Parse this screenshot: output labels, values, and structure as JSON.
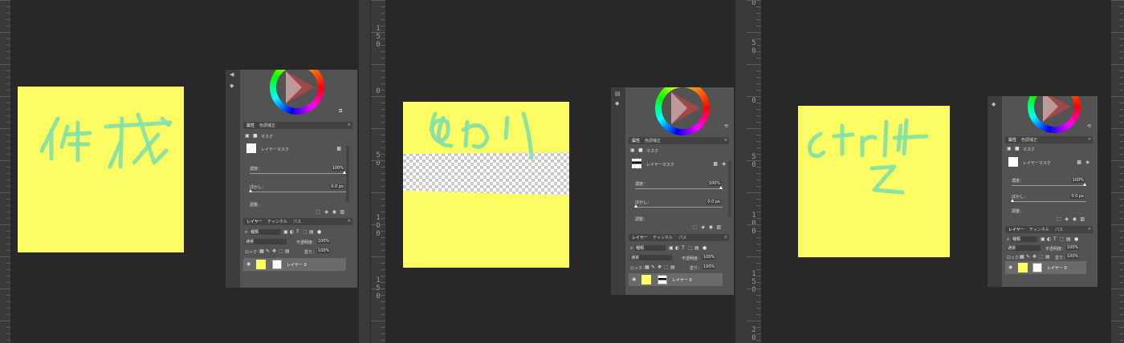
{
  "rulers": {
    "left_ruler_numbers": [
      "1",
      "5",
      "0",
      "0",
      "5",
      "0",
      "1",
      "0",
      "0",
      "1",
      "5",
      "0"
    ],
    "right_ruler_numbers": [
      "0",
      "5",
      "0",
      "0",
      "5",
      "0",
      "1",
      "0",
      "0",
      "1",
      "5",
      "0",
      "2",
      "0"
    ]
  },
  "notes": [
    {
      "text": "作成",
      "color": "#fdfc62"
    },
    {
      "text": "ぬり",
      "color": "#fdfc62"
    },
    {
      "text": "ctrl+z",
      "color": "#fdfc62"
    }
  ],
  "panels": [
    {
      "props_tab": "属性",
      "adjust_tab": "色調補正",
      "mask_label": "マスク",
      "layer_mask_label": "レイヤーマスク",
      "density_label": "濃度：",
      "density_value": "100%",
      "feather_label": "ぼかし：",
      "feather_value": "0.0 px",
      "adjust_label": "調整：",
      "layers_tab": "レイヤー",
      "channels_tab": "チャンネル",
      "paths_tab": "パス",
      "kind_label": "種類",
      "blend_label": "通常",
      "opacity_label": "不透明度：",
      "opacity_value": "100%",
      "lock_label": "ロック：",
      "fill_label": "塗り：",
      "fill_value": "100%",
      "layer_name": "レイヤー 0"
    },
    {
      "props_tab": "属性",
      "adjust_tab": "色調補正",
      "mask_label": "マスク",
      "layer_mask_label": "レイヤーマスク",
      "density_label": "濃度：",
      "density_value": "100%",
      "feather_label": "ぼかし：",
      "feather_value": "0.0 px",
      "adjust_label": "調整：",
      "layers_tab": "レイヤー",
      "channels_tab": "チャンネル",
      "paths_tab": "パス",
      "kind_label": "種類",
      "blend_label": "通常",
      "opacity_label": "不透明度：",
      "opacity_value": "100%",
      "lock_label": "ロック：",
      "fill_label": "塗り：",
      "fill_value": "100%",
      "layer_name": "レイヤー 0"
    },
    {
      "props_tab": "属性",
      "adjust_tab": "色調補正",
      "mask_label": "マスク",
      "layer_mask_label": "レイヤーマスク",
      "density_label": "濃度：",
      "density_value": "100%",
      "feather_label": "ぼかし：",
      "feather_value": "0.0 px",
      "adjust_label": "調整：",
      "layers_tab": "レイヤー",
      "channels_tab": "チャンネル",
      "paths_tab": "パス",
      "kind_label": "種類",
      "blend_label": "通常",
      "opacity_label": "不透明度：",
      "opacity_value": "100%",
      "lock_label": "ロック：",
      "fill_label": "塗り：",
      "fill_value": "100%",
      "layer_name": "レイヤー 0"
    }
  ],
  "colors": {
    "note_yellow": "#fdfc62",
    "stroke_green": "#7fe0a8",
    "canvas_bg": "#282828",
    "panel_bg": "#535353"
  }
}
